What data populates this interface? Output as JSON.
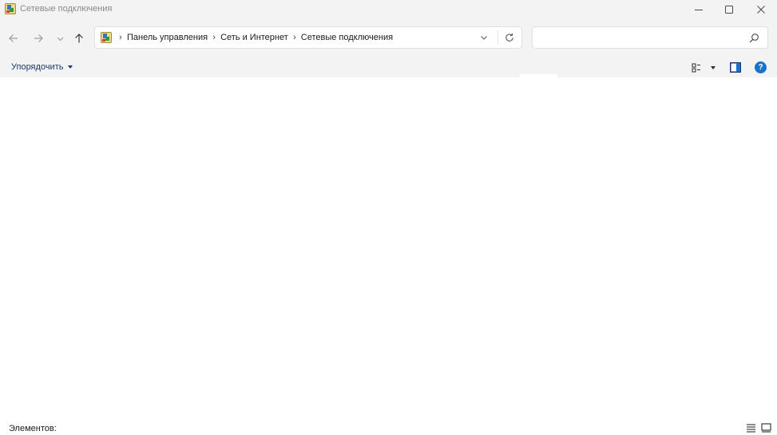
{
  "window": {
    "title": "Сетевые подключения",
    "controls": {
      "minimize": "minimize-icon",
      "maximize": "maximize-icon",
      "close": "close-icon"
    }
  },
  "navigation": {
    "back_icon": "arrow-left-icon",
    "forward_icon": "arrow-right-icon",
    "recent_icon": "chevron-down-icon",
    "up_icon": "arrow-up-icon"
  },
  "address": {
    "icon": "control-panel-icon",
    "breadcrumbs": [
      {
        "label": "Панель управления"
      },
      {
        "label": "Сеть и Интернет"
      },
      {
        "label": "Сетевые подключения"
      }
    ],
    "separator": "›"
  },
  "search": {
    "value": "",
    "placeholder": ""
  },
  "commandbar": {
    "organize_label": "Упорядочить",
    "help_label": "?"
  },
  "statusbar": {
    "items_label": "Элементов:"
  },
  "colors": {
    "chrome_background": "#f3f3f3",
    "accent_blue": "#1a73c9",
    "organize_text": "#1b3a6b"
  }
}
